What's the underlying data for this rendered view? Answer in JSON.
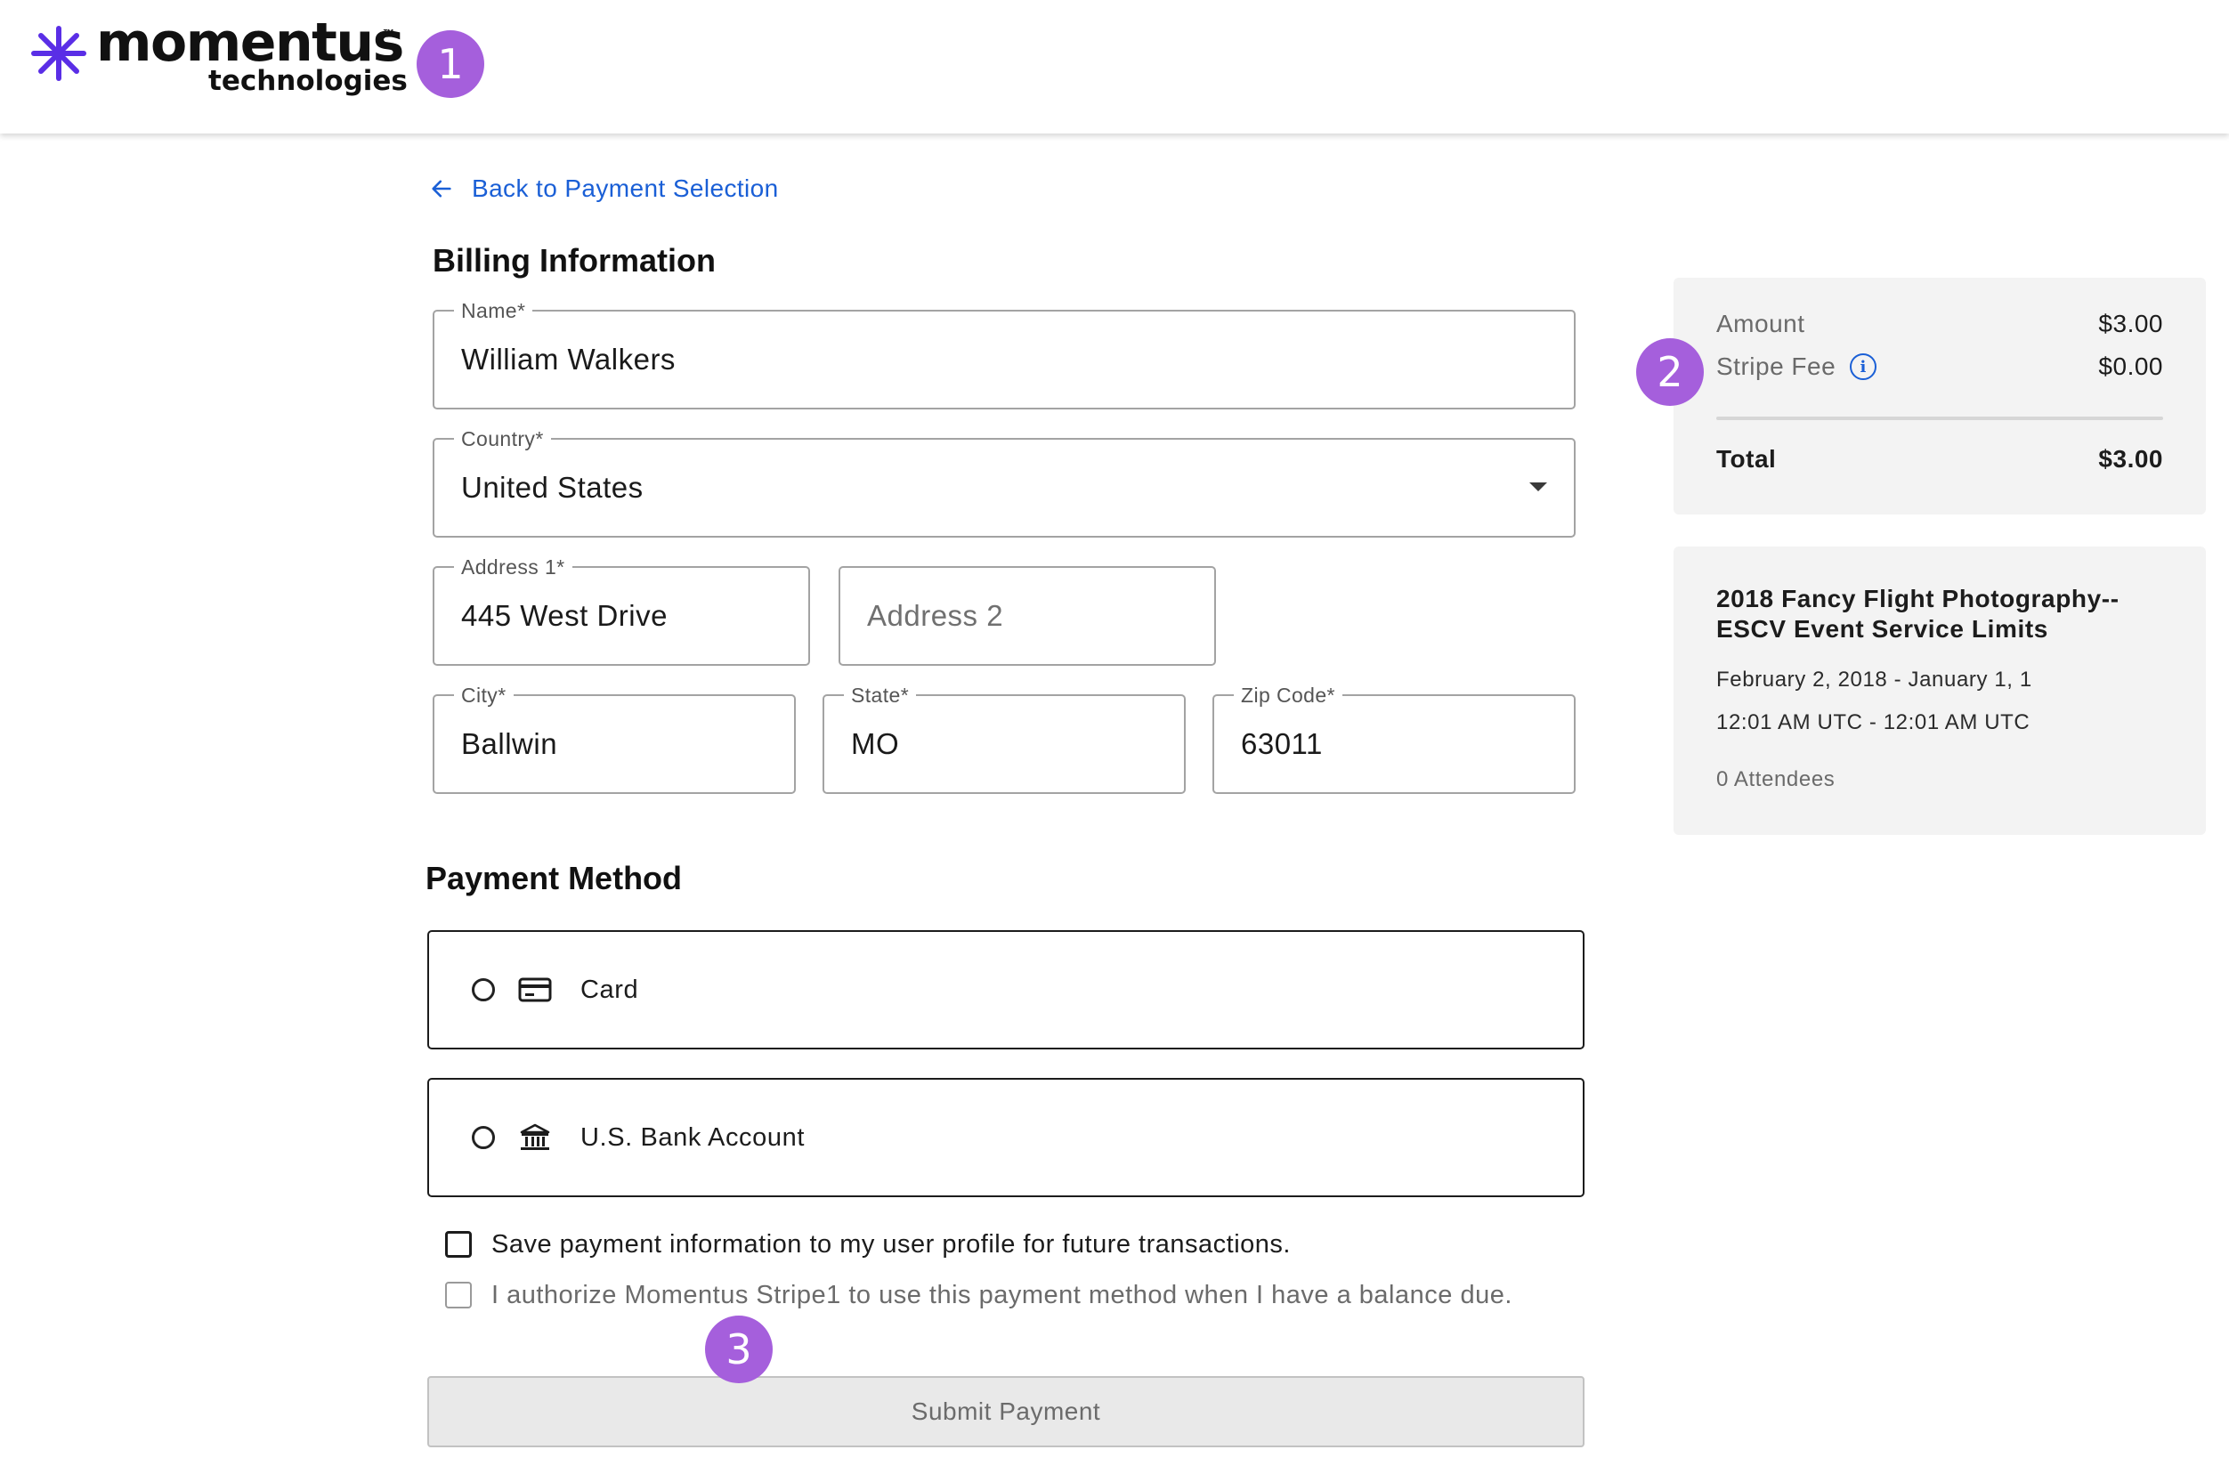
{
  "header": {
    "logo_word": "momentus",
    "logo_sub": "technologies",
    "logo_tm": "™",
    "brand_color": "#5a2ee6"
  },
  "markers": [
    "1",
    "2",
    "3"
  ],
  "back_link": {
    "label": "Back to Payment Selection"
  },
  "billing": {
    "title": "Billing Information",
    "name": {
      "label": "Name*",
      "value": "William Walkers"
    },
    "country": {
      "label": "Country*",
      "value": "United States"
    },
    "address1": {
      "label": "Address 1*",
      "value": "445 West Drive"
    },
    "address2": {
      "placeholder": "Address 2"
    },
    "city": {
      "label": "City*",
      "value": "Ballwin"
    },
    "state": {
      "label": "State*",
      "value": "MO"
    },
    "zip": {
      "label": "Zip Code*",
      "value": "63011"
    }
  },
  "payment": {
    "title": "Payment Method",
    "options": [
      {
        "label": "Card",
        "icon": "credit-card-icon",
        "selected": false
      },
      {
        "label": "U.S. Bank Account",
        "icon": "bank-icon",
        "selected": false
      }
    ],
    "save_checkbox": {
      "label": "Save payment information to my user profile for future transactions.",
      "checked": false
    },
    "authorize_checkbox": {
      "label": "I authorize Momentus Stripe1 to use this payment method when I have a balance due.",
      "checked": false,
      "disabled": true
    },
    "submit_label": "Submit Payment"
  },
  "summary": {
    "amount_label": "Amount",
    "amount_value": "$3.00",
    "fee_label": "Stripe Fee",
    "fee_value": "$0.00",
    "info_glyph": "i",
    "total_label": "Total",
    "total_value": "$3.00"
  },
  "event": {
    "title": "2018 Fancy Flight Photography--ESCV Event Service Limits",
    "dates": "February 2, 2018 - January 1, 1",
    "times": "12:01 AM UTC - 12:01 AM UTC",
    "attendees": "0 Attendees"
  },
  "colors": {
    "marker": "#a55fdc",
    "link": "#1a5fd6",
    "panel_bg": "#f3f3f3"
  }
}
